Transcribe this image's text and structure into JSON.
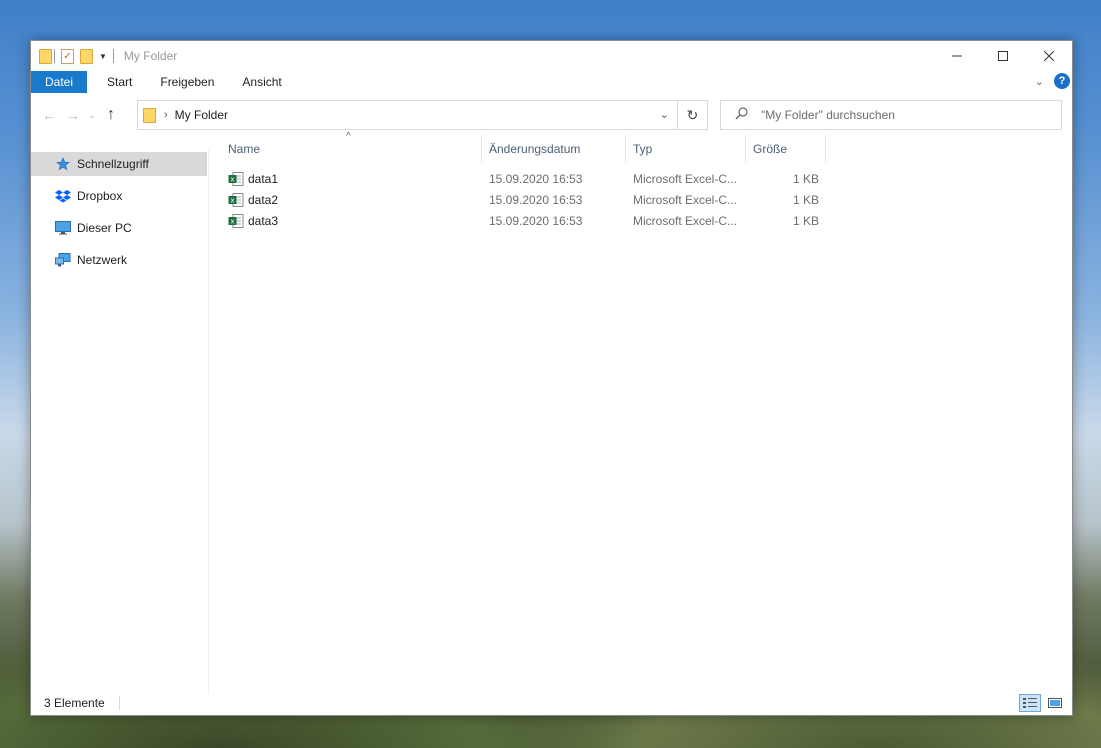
{
  "window": {
    "title": "My Folder"
  },
  "ribbon": {
    "tabs": [
      "Datei",
      "Start",
      "Freigeben",
      "Ansicht"
    ],
    "help_label": "?"
  },
  "window_buttons": {
    "minimize": "—",
    "maximize": "☐",
    "close": "✕"
  },
  "navigation": {
    "back": "←",
    "forward": "→",
    "recent": "⌄",
    "up": "↑"
  },
  "address": {
    "crumb": "My Folder",
    "separator": "›",
    "refresh": "↻",
    "dropdown": "⌄"
  },
  "search": {
    "placeholder": "\"My Folder\" durchsuchen",
    "icon": "search-icon"
  },
  "sidebar": {
    "items": [
      {
        "label": "Schnellzugriff",
        "icon": "star-icon",
        "selected": true
      },
      {
        "label": "Dropbox",
        "icon": "dropbox-icon",
        "selected": false
      },
      {
        "label": "Dieser PC",
        "icon": "computer-icon",
        "selected": false
      },
      {
        "label": "Netzwerk",
        "icon": "network-icon",
        "selected": false
      }
    ]
  },
  "columns": {
    "name": "Name",
    "date": "Änderungsdatum",
    "type": "Typ",
    "size": "Größe"
  },
  "files": [
    {
      "name": "data1",
      "date": "15.09.2020 16:53",
      "type": "Microsoft Excel-C...",
      "size": "1 KB",
      "icon": "excel-csv-icon"
    },
    {
      "name": "data2",
      "date": "15.09.2020 16:53",
      "type": "Microsoft Excel-C...",
      "size": "1 KB",
      "icon": "excel-csv-icon"
    },
    {
      "name": "data3",
      "date": "15.09.2020 16:53",
      "type": "Microsoft Excel-C...",
      "size": "1 KB",
      "icon": "excel-csv-icon"
    }
  ],
  "status": {
    "count": "3 Elemente"
  },
  "colors": {
    "accent": "#1979ca",
    "header_text": "#4c607a",
    "selected_bg": "#d9d9d9"
  }
}
